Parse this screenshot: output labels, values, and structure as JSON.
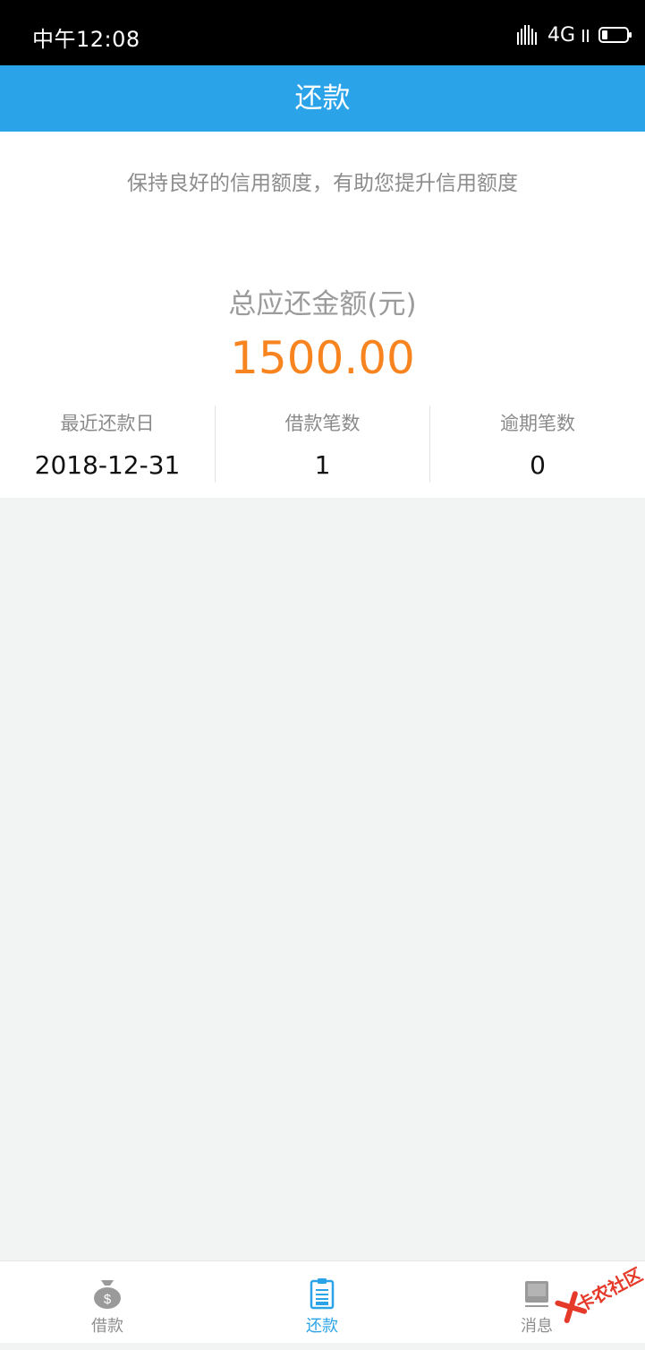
{
  "status_bar": {
    "time": "中午12:08",
    "network": "4G"
  },
  "nav": {
    "title": "还款"
  },
  "summary": {
    "tip": "保持良好的信用额度，有助您提升信用额度",
    "total_label": "总应还金额(元)",
    "total_amount": "1500.00",
    "stats": [
      {
        "label": "最近还款日",
        "value": "2018-12-31"
      },
      {
        "label": "借款笔数",
        "value": "1"
      },
      {
        "label": "逾期笔数",
        "value": "0"
      }
    ]
  },
  "tabs": [
    {
      "label": "借款",
      "icon": "money-bag-icon",
      "active": false
    },
    {
      "label": "还款",
      "icon": "clipboard-icon",
      "active": true
    },
    {
      "label": "消息",
      "icon": "message-icon",
      "active": false
    }
  ],
  "watermark": {
    "text": "卡农社区"
  },
  "colors": {
    "accent": "#2ba3e8",
    "amount": "#f8841f",
    "background": "#f2f3f3"
  }
}
